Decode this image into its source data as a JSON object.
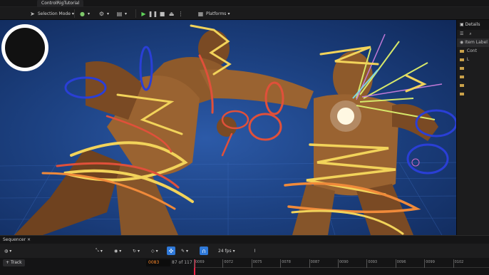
{
  "window": {
    "tab_title": "ControlRigTutorial"
  },
  "toolbar": {
    "mode_label": "Selection Mode",
    "platforms_label": "Platforms"
  },
  "details": {
    "title": "Details",
    "items": [
      "Item Label",
      "Cont",
      "L"
    ]
  },
  "sequencer": {
    "tab_label": "Sequencer",
    "fps_label": "24 fps",
    "track_button": "Track",
    "current_frame": "0083",
    "frame_of": "87 of 117",
    "ticks": [
      "0069",
      "0072",
      "0075",
      "0078",
      "0087",
      "0090",
      "0093",
      "0096",
      "0099",
      "0102"
    ]
  },
  "colors": {
    "accent": "#2f79d9",
    "viewport_bg": "#1d4283",
    "scribble_red": "#e0503a",
    "scribble_yellow": "#f2d35a",
    "scribble_blue": "#2a3fd6",
    "scribble_orange": "#f08a3a"
  },
  "icons": {
    "logo": "unreal-engine-logo",
    "play": "play-icon",
    "pause": "pause-icon",
    "stop": "stop-icon",
    "eject": "eject-icon",
    "snap": "magnet-icon"
  }
}
